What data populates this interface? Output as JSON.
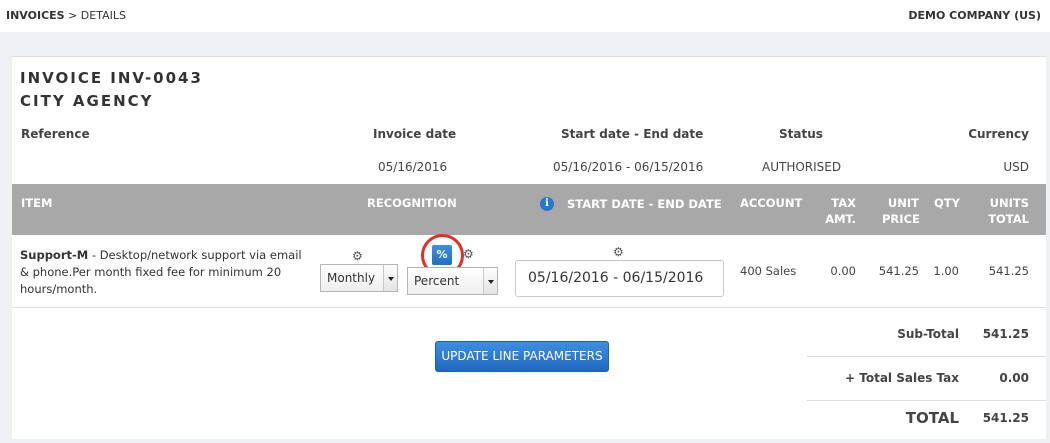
{
  "breadcrumb": {
    "root": "INVOICES",
    "separator": ">",
    "current": "DETAILS"
  },
  "company": "DEMO COMPANY (US)",
  "invoice": {
    "title": "INVOICE INV-0043",
    "customer": "CITY AGENCY"
  },
  "meta": {
    "reference_label": "Reference",
    "invoice_date_label": "Invoice date",
    "period_label": "Start date - End date",
    "status_label": "Status",
    "currency_label": "Currency",
    "invoice_date": "05/16/2016",
    "period": "05/16/2016 - 06/15/2016",
    "status": "AUTHORISED",
    "currency": "USD"
  },
  "table": {
    "headers": {
      "item": "ITEM",
      "recognition": "RECOGNITION",
      "period": "START DATE - END DATE",
      "account": "ACCOUNT",
      "tax_line1": "TAX",
      "tax_line2": "AMT.",
      "unit_line1": "UNIT",
      "unit_line2": "PRICE",
      "qty": "QTY",
      "units_line1": "UNITS",
      "units_line2": "TOTAL"
    },
    "info_icon": "i",
    "row": {
      "item_name": "Support-M",
      "item_desc": " - Desktop/network support via email & phone.Per month fixed fee for minimum 20 hours/month.",
      "frequency": "Monthly",
      "percent_button": "%",
      "method": "Percent",
      "date_range": "05/16/2016 - 06/15/2016",
      "account": "400 Sales",
      "tax": "0.00",
      "unit_price": "541.25",
      "qty": "1.00",
      "total": "541.25"
    }
  },
  "update_button": "UPDATE LINE PARAMETERS",
  "totals": {
    "subtotal_label": "Sub-Total",
    "subtotal": "541.25",
    "tax_label": "+ Total Sales Tax",
    "tax": "0.00",
    "total_label": "TOTAL",
    "total": "541.25"
  },
  "icons": {
    "gear": "gear-icon",
    "info": "info-icon",
    "dropdown": "chevron-down-icon"
  },
  "colors": {
    "accent": "#2a77c9",
    "header_bg": "#a8a8a8",
    "highlight": "#e0302b",
    "page_bg": "#eef0f5"
  }
}
